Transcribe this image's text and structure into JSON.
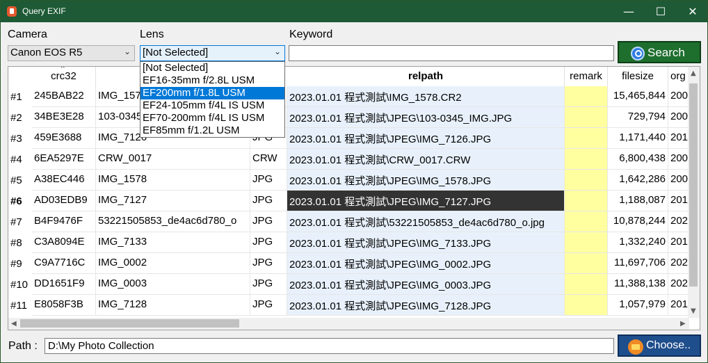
{
  "window": {
    "title": "Query EXIF",
    "min": "—",
    "max": "☐",
    "close": "✕"
  },
  "filters": {
    "camera_label": "Camera",
    "camera_value": "Canon EOS R5",
    "lens_label": "Lens",
    "lens_value": "[Not Selected]",
    "keyword_label": "Keyword",
    "keyword_value": "",
    "search_label": "Search"
  },
  "lens_options": [
    "[Not Selected]",
    "EF16-35mm f/2.8L USM",
    "EF200mm f/1.8L USM",
    "EF24-105mm f/4L IS USM",
    "EF70-200mm f/4L IS USM",
    "EF85mm f/1.2L USM"
  ],
  "lens_highlighted_index": 2,
  "columns": {
    "crc32": "crc32",
    "relpath": "relpath",
    "remark": "remark",
    "filesize": "filesize",
    "org": "org"
  },
  "rows": [
    {
      "num": "#1",
      "crc": "245BAB22",
      "name": "IMG_1578",
      "ext": "CR2",
      "path": "2023.01.01 程式測試\\IMG_1578.CR2",
      "remark": "",
      "size": "15,465,844",
      "org": "200"
    },
    {
      "num": "#2",
      "crc": "34BE3E28",
      "name": "103-0345_IMG",
      "ext": "JPG",
      "path": "2023.01.01 程式測試\\JPEG\\103-0345_IMG.JPG",
      "remark": "",
      "size": "729,794",
      "org": "200"
    },
    {
      "num": "#3",
      "crc": "459E3688",
      "name": "IMG_7126",
      "ext": "JPG",
      "path": "2023.01.01 程式測試\\JPEG\\IMG_7126.JPG",
      "remark": "",
      "size": "1,171,440",
      "org": "201"
    },
    {
      "num": "#4",
      "crc": "6EA5297E",
      "name": "CRW_0017",
      "ext": "CRW",
      "path": "2023.01.01 程式測試\\CRW_0017.CRW",
      "remark": "",
      "size": "6,800,438",
      "org": "200"
    },
    {
      "num": "#5",
      "crc": "A38EC446",
      "name": "IMG_1578",
      "ext": "JPG",
      "path": "2023.01.01 程式測試\\JPEG\\IMG_1578.JPG",
      "remark": "",
      "size": "1,642,286",
      "org": "200"
    },
    {
      "num": "#6",
      "crc": "AD03EDB9",
      "name": "IMG_7127",
      "ext": "JPG",
      "path": "2023.01.01 程式測試\\JPEG\\IMG_7127.JPG",
      "remark": "",
      "size": "1,188,087",
      "org": "201"
    },
    {
      "num": "#7",
      "crc": "B4F9476F",
      "name": "53221505853_de4ac6d780_o",
      "ext": "JPG",
      "path": "2023.01.01 程式測試\\53221505853_de4ac6d780_o.jpg",
      "remark": "",
      "size": "10,878,244",
      "org": "202"
    },
    {
      "num": "#8",
      "crc": "C3A8094E",
      "name": "IMG_7133",
      "ext": "JPG",
      "path": "2023.01.01 程式測試\\JPEG\\IMG_7133.JPG",
      "remark": "",
      "size": "1,332,240",
      "org": "201"
    },
    {
      "num": "#9",
      "crc": "C9A7716C",
      "name": "IMG_0002",
      "ext": "JPG",
      "path": "2023.01.01 程式測試\\JPEG\\IMG_0002.JPG",
      "remark": "",
      "size": "11,697,706",
      "org": "202"
    },
    {
      "num": "#10",
      "crc": "DD1651F9",
      "name": "IMG_0003",
      "ext": "JPG",
      "path": "2023.01.01 程式測試\\JPEG\\IMG_0003.JPG",
      "remark": "",
      "size": "11,388,138",
      "org": "202"
    },
    {
      "num": "#11",
      "crc": "E8058F3B",
      "name": "IMG_7128",
      "ext": "JPG",
      "path": "2023.01.01 程式測試\\JPEG\\IMG_7128.JPG",
      "remark": "",
      "size": "1,057,979",
      "org": "201"
    }
  ],
  "selected_row": "#6",
  "footer": {
    "path_label": "Path :",
    "path_value": "D:\\My Photo Collection",
    "choose_label": "Choose.."
  },
  "colors": {
    "titlebar": "#1e5a36",
    "search_button": "#1e6e2e",
    "choose_button": "#1f4e8c",
    "relpath_bg": "#e8f1fb",
    "remark_bg": "#ffffa0",
    "selected_bg": "#333333"
  }
}
